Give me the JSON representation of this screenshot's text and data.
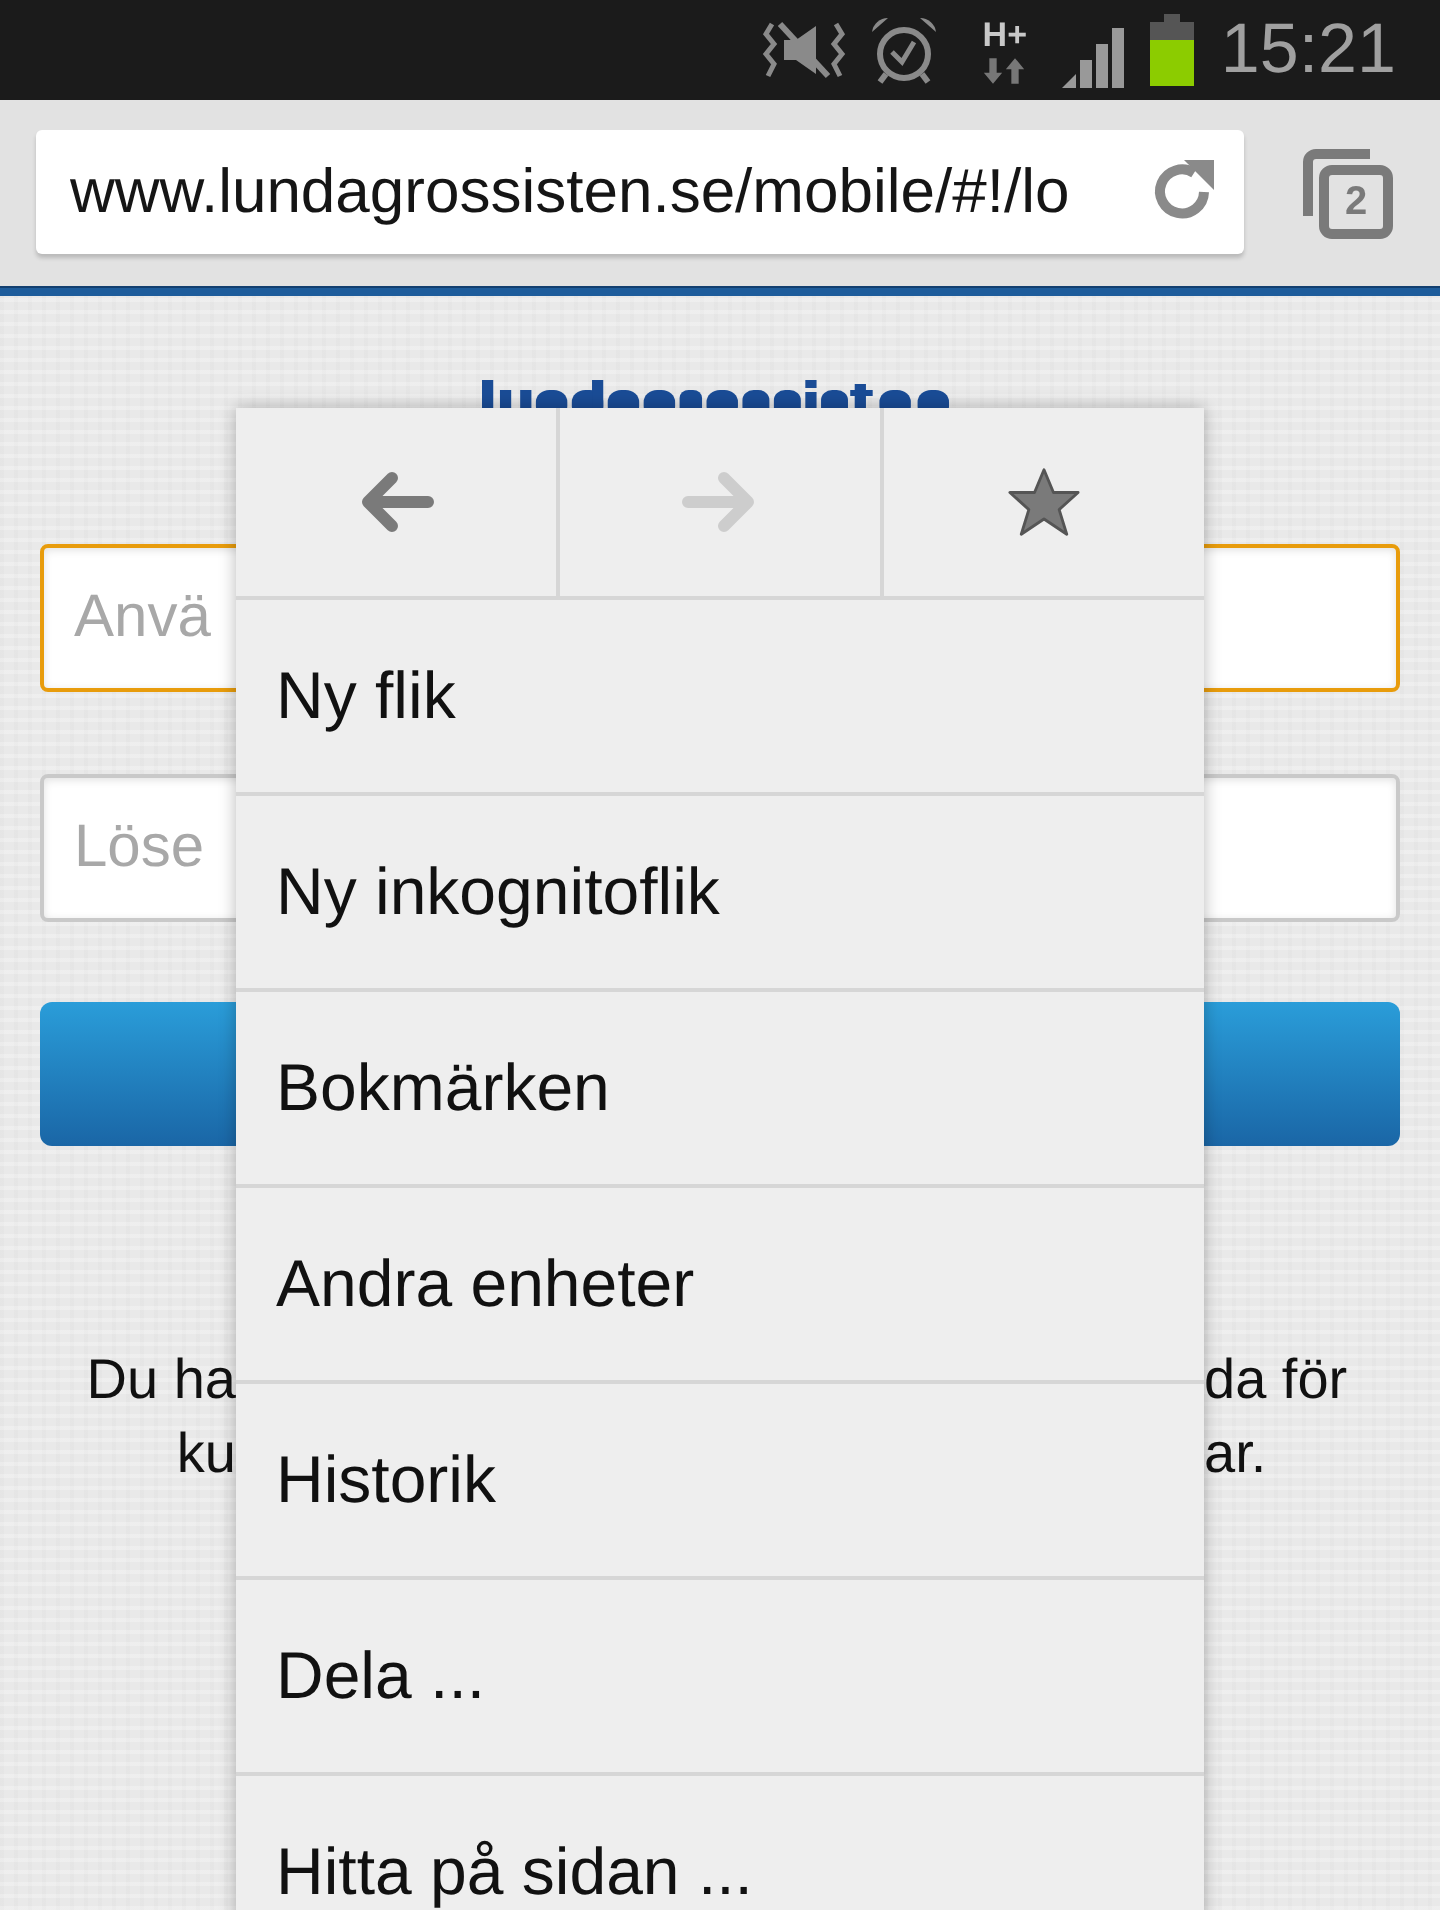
{
  "status_bar": {
    "network_type": "H+",
    "time": "15:21"
  },
  "browser_toolbar": {
    "url": "www.lundagrossisten.se/mobile/#!/lo",
    "tab_count": "2"
  },
  "page": {
    "fields": [
      {
        "placeholder": "Anvä",
        "focused": true
      },
      {
        "placeholder": "Löse",
        "focused": false
      }
    ],
    "notice_lines": [
      {
        "left": "Du ha",
        "right": "da för"
      },
      {
        "left": "ku",
        "right": "ar."
      }
    ]
  },
  "menu": {
    "nav_buttons": [
      {
        "kind": "back",
        "disabled": false
      },
      {
        "kind": "forward",
        "disabled": true
      },
      {
        "kind": "bookmark",
        "disabled": false
      }
    ],
    "items": [
      "Ny flik",
      "Ny inkognitoflik",
      "Bokmärken",
      "Andra enheter",
      "Historik",
      "Dela ...",
      "Hitta på sidan ..."
    ]
  }
}
